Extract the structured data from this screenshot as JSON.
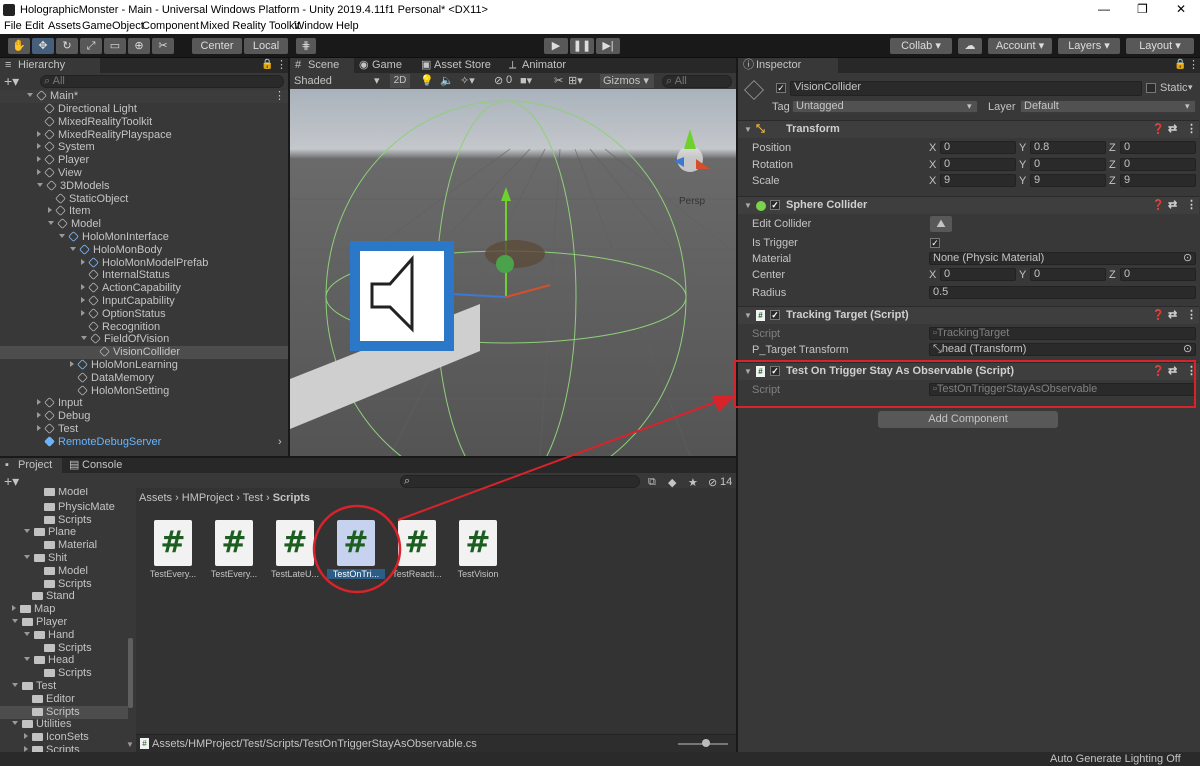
{
  "window": {
    "title": "HolographicMonster - Main - Universal Windows Platform - Unity 2019.4.11f1 Personal* <DX11>",
    "controls": [
      "—",
      "❐",
      "✕"
    ]
  },
  "menu": [
    "File",
    "Edit",
    "Assets",
    "GameObject",
    "Component",
    "Mixed Reality Toolkit",
    "Window",
    "Help"
  ],
  "toolbar": {
    "pivot": "Center",
    "space": "Local",
    "collab": "Collab",
    "account": "Account",
    "layers": "Layers",
    "layout": "Layout"
  },
  "hierarchy": {
    "tab": "Hierarchy",
    "search_placeholder": "All",
    "scene": "Main*",
    "items": [
      {
        "label": "Directional Light"
      },
      {
        "label": "MixedRealityToolkit"
      },
      {
        "label": "MixedRealityPlayspace"
      },
      {
        "label": "System"
      },
      {
        "label": "Player"
      },
      {
        "label": "View"
      },
      {
        "label": "3DModels"
      },
      {
        "label": "StaticObject"
      },
      {
        "label": "Item"
      },
      {
        "label": "Model"
      },
      {
        "label": "HoloMonInterface"
      },
      {
        "label": "HoloMonBody"
      },
      {
        "label": "HoloMonModelPrefab"
      },
      {
        "label": "InternalStatus"
      },
      {
        "label": "ActionCapability"
      },
      {
        "label": "InputCapability"
      },
      {
        "label": "OptionStatus"
      },
      {
        "label": "Recognition"
      },
      {
        "label": "FieldOfVision"
      },
      {
        "label": "VisionCollider"
      },
      {
        "label": "HoloMonLearning"
      },
      {
        "label": "DataMemory"
      },
      {
        "label": "HoloMonSetting"
      },
      {
        "label": "Input"
      },
      {
        "label": "Debug"
      },
      {
        "label": "Test"
      },
      {
        "label": "RemoteDebugServer"
      }
    ]
  },
  "scene": {
    "tabs": [
      "Scene",
      "Game",
      "Asset Store",
      "Animator"
    ],
    "shading": "Shaded",
    "mode_2d": "2D",
    "hidden_count": "0",
    "gizmos": "Gizmos",
    "search_placeholder": "All",
    "persp": "Persp"
  },
  "project": {
    "tabs": [
      "Project",
      "Console"
    ],
    "hidden_count": "14",
    "breadcrumb": [
      "Assets",
      "HMProject",
      "Test",
      "Scripts"
    ],
    "tree": [
      {
        "label": "Model"
      },
      {
        "label": "PhysicMate"
      },
      {
        "label": "Scripts"
      },
      {
        "label": "Plane"
      },
      {
        "label": "Material"
      },
      {
        "label": "Shit"
      },
      {
        "label": "Model"
      },
      {
        "label": "Scripts"
      },
      {
        "label": "Stand"
      },
      {
        "label": "Map"
      },
      {
        "label": "Player"
      },
      {
        "label": "Hand"
      },
      {
        "label": "Scripts"
      },
      {
        "label": "Head"
      },
      {
        "label": "Scripts"
      },
      {
        "label": "Test"
      },
      {
        "label": "Editor"
      },
      {
        "label": "Scripts"
      },
      {
        "label": "Utilities"
      },
      {
        "label": "IconSets"
      },
      {
        "label": "Scripts"
      }
    ],
    "files": [
      {
        "label": "TestEvery..."
      },
      {
        "label": "TestEvery..."
      },
      {
        "label": "TestLateU..."
      },
      {
        "label": "TestOnTri..."
      },
      {
        "label": "TestReacti..."
      },
      {
        "label": "TestVision"
      }
    ],
    "status_path": "Assets/HMProject/Test/Scripts/TestOnTriggerStayAsObservable.cs"
  },
  "inspector": {
    "tab": "Inspector",
    "object_name": "VisionCollider",
    "static_label": "Static",
    "tag_label": "Tag",
    "tag_value": "Untagged",
    "layer_label": "Layer",
    "layer_value": "Default",
    "transform": {
      "title": "Transform",
      "position_label": "Position",
      "rotation_label": "Rotation",
      "scale_label": "Scale",
      "position": {
        "x": "0",
        "y": "0.8",
        "z": "0"
      },
      "rotation": {
        "x": "0",
        "y": "0",
        "z": "0"
      },
      "scale": {
        "x": "9",
        "y": "9",
        "z": "9"
      }
    },
    "sphere_collider": {
      "title": "Sphere Collider",
      "edit_collider_label": "Edit Collider",
      "is_trigger_label": "Is Trigger",
      "material_label": "Material",
      "material_value": "None (Physic Material)",
      "center_label": "Center",
      "center": {
        "x": "0",
        "y": "0",
        "z": "0"
      },
      "radius_label": "Radius",
      "radius_value": "0.5"
    },
    "tracking_target": {
      "title": "Tracking Target (Script)",
      "script_label": "Script",
      "script_value": "TrackingTarget",
      "target_label": "P_Target Transform",
      "target_value": "head (Transform)"
    },
    "test_trigger": {
      "title": "Test On Trigger Stay As Observable (Script)",
      "script_label": "Script",
      "script_value": "TestOnTriggerStayAsObservable"
    },
    "add_component": "Add Component"
  },
  "statusbar": {
    "text": "Auto Generate Lighting Off"
  },
  "colors": {
    "highlight": "#d9232b",
    "selection": "#2c5d87",
    "link": "#6ab4ff"
  }
}
